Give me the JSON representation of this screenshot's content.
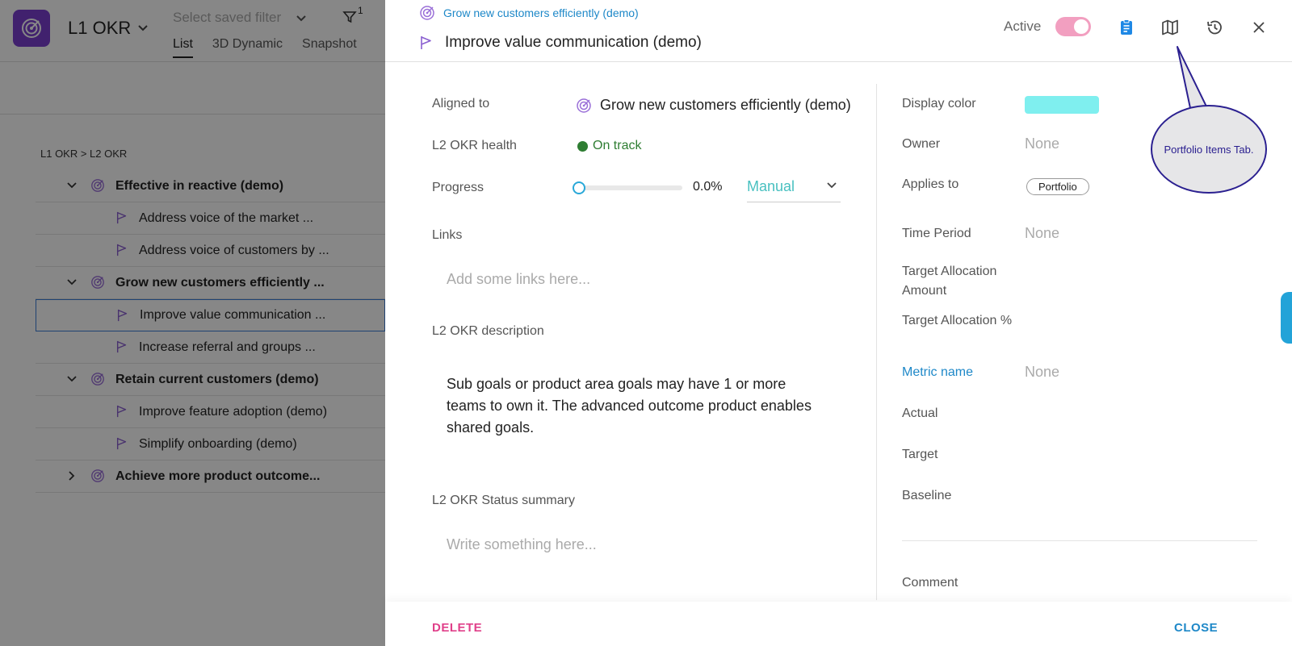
{
  "app": {
    "title": "L1 OKR",
    "filter_placeholder": "Select saved filter",
    "filter_count": "1",
    "tabs": [
      "List",
      "3D Dynamic",
      "Snapshot"
    ],
    "breadcrumb": "L1 OKR > L2 OKR",
    "tree": [
      {
        "label": "Effective in reactive (demo)",
        "level": 1,
        "expanded": true
      },
      {
        "label": "Address voice of the market ...",
        "level": 2
      },
      {
        "label": "Address voice of customers by ...",
        "level": 2
      },
      {
        "label": "Grow new customers efficiently ...",
        "level": 1,
        "expanded": true
      },
      {
        "label": "Improve value communication ...",
        "level": 2,
        "selected": true
      },
      {
        "label": "Increase referral and groups ...",
        "level": 2
      },
      {
        "label": "Retain current customers (demo)",
        "level": 1,
        "expanded": true
      },
      {
        "label": "Improve feature adoption (demo)",
        "level": 2
      },
      {
        "label": "Simplify onboarding (demo)",
        "level": 2
      },
      {
        "label": "Achieve more product outcome...",
        "level": 1,
        "expanded": false
      }
    ]
  },
  "panel": {
    "parent_link": "Grow new customers efficiently (demo)",
    "title": "Improve value communication (demo)",
    "active_label": "Active",
    "active": true,
    "left": {
      "aligned_label": "Aligned to",
      "aligned_value": "Grow new customers efficiently (demo)",
      "health_label": "L2 OKR health",
      "health_value": "On track",
      "progress_label": "Progress",
      "progress_value": 0.0,
      "progress_text": "0.0%",
      "progress_mode": "Manual",
      "links_label": "Links",
      "links_placeholder": "Add some links here...",
      "description_label": "L2 OKR description",
      "description": "Sub goals or product area goals may have 1 or more teams to own it. The advanced outcome product enables shared goals.",
      "status_label": "L2 OKR Status summary",
      "status_placeholder": "Write something here..."
    },
    "right": {
      "display_color_label": "Display color",
      "display_color": "#7fefef",
      "owner_label": "Owner",
      "owner_value": "None",
      "applies_label": "Applies to",
      "applies_value": "Portfolio",
      "time_period_label": "Time Period",
      "time_period_value": "None",
      "target_alloc_amount_label": "Target Allocation Amount",
      "target_alloc_pct_label": "Target Allocation %",
      "metric_name_label": "Metric name",
      "metric_name_value": "None",
      "actual_label": "Actual",
      "target_label": "Target",
      "baseline_label": "Baseline",
      "comment_label": "Comment"
    },
    "footer": {
      "delete": "DELETE",
      "close": "CLOSE"
    }
  },
  "callout": "Portfolio Items Tab.",
  "colors": {
    "accent_blue": "#1e88c8",
    "purple": "#7b3fd0",
    "pink": "#e0408a",
    "on_track_green": "#2e7d32"
  }
}
